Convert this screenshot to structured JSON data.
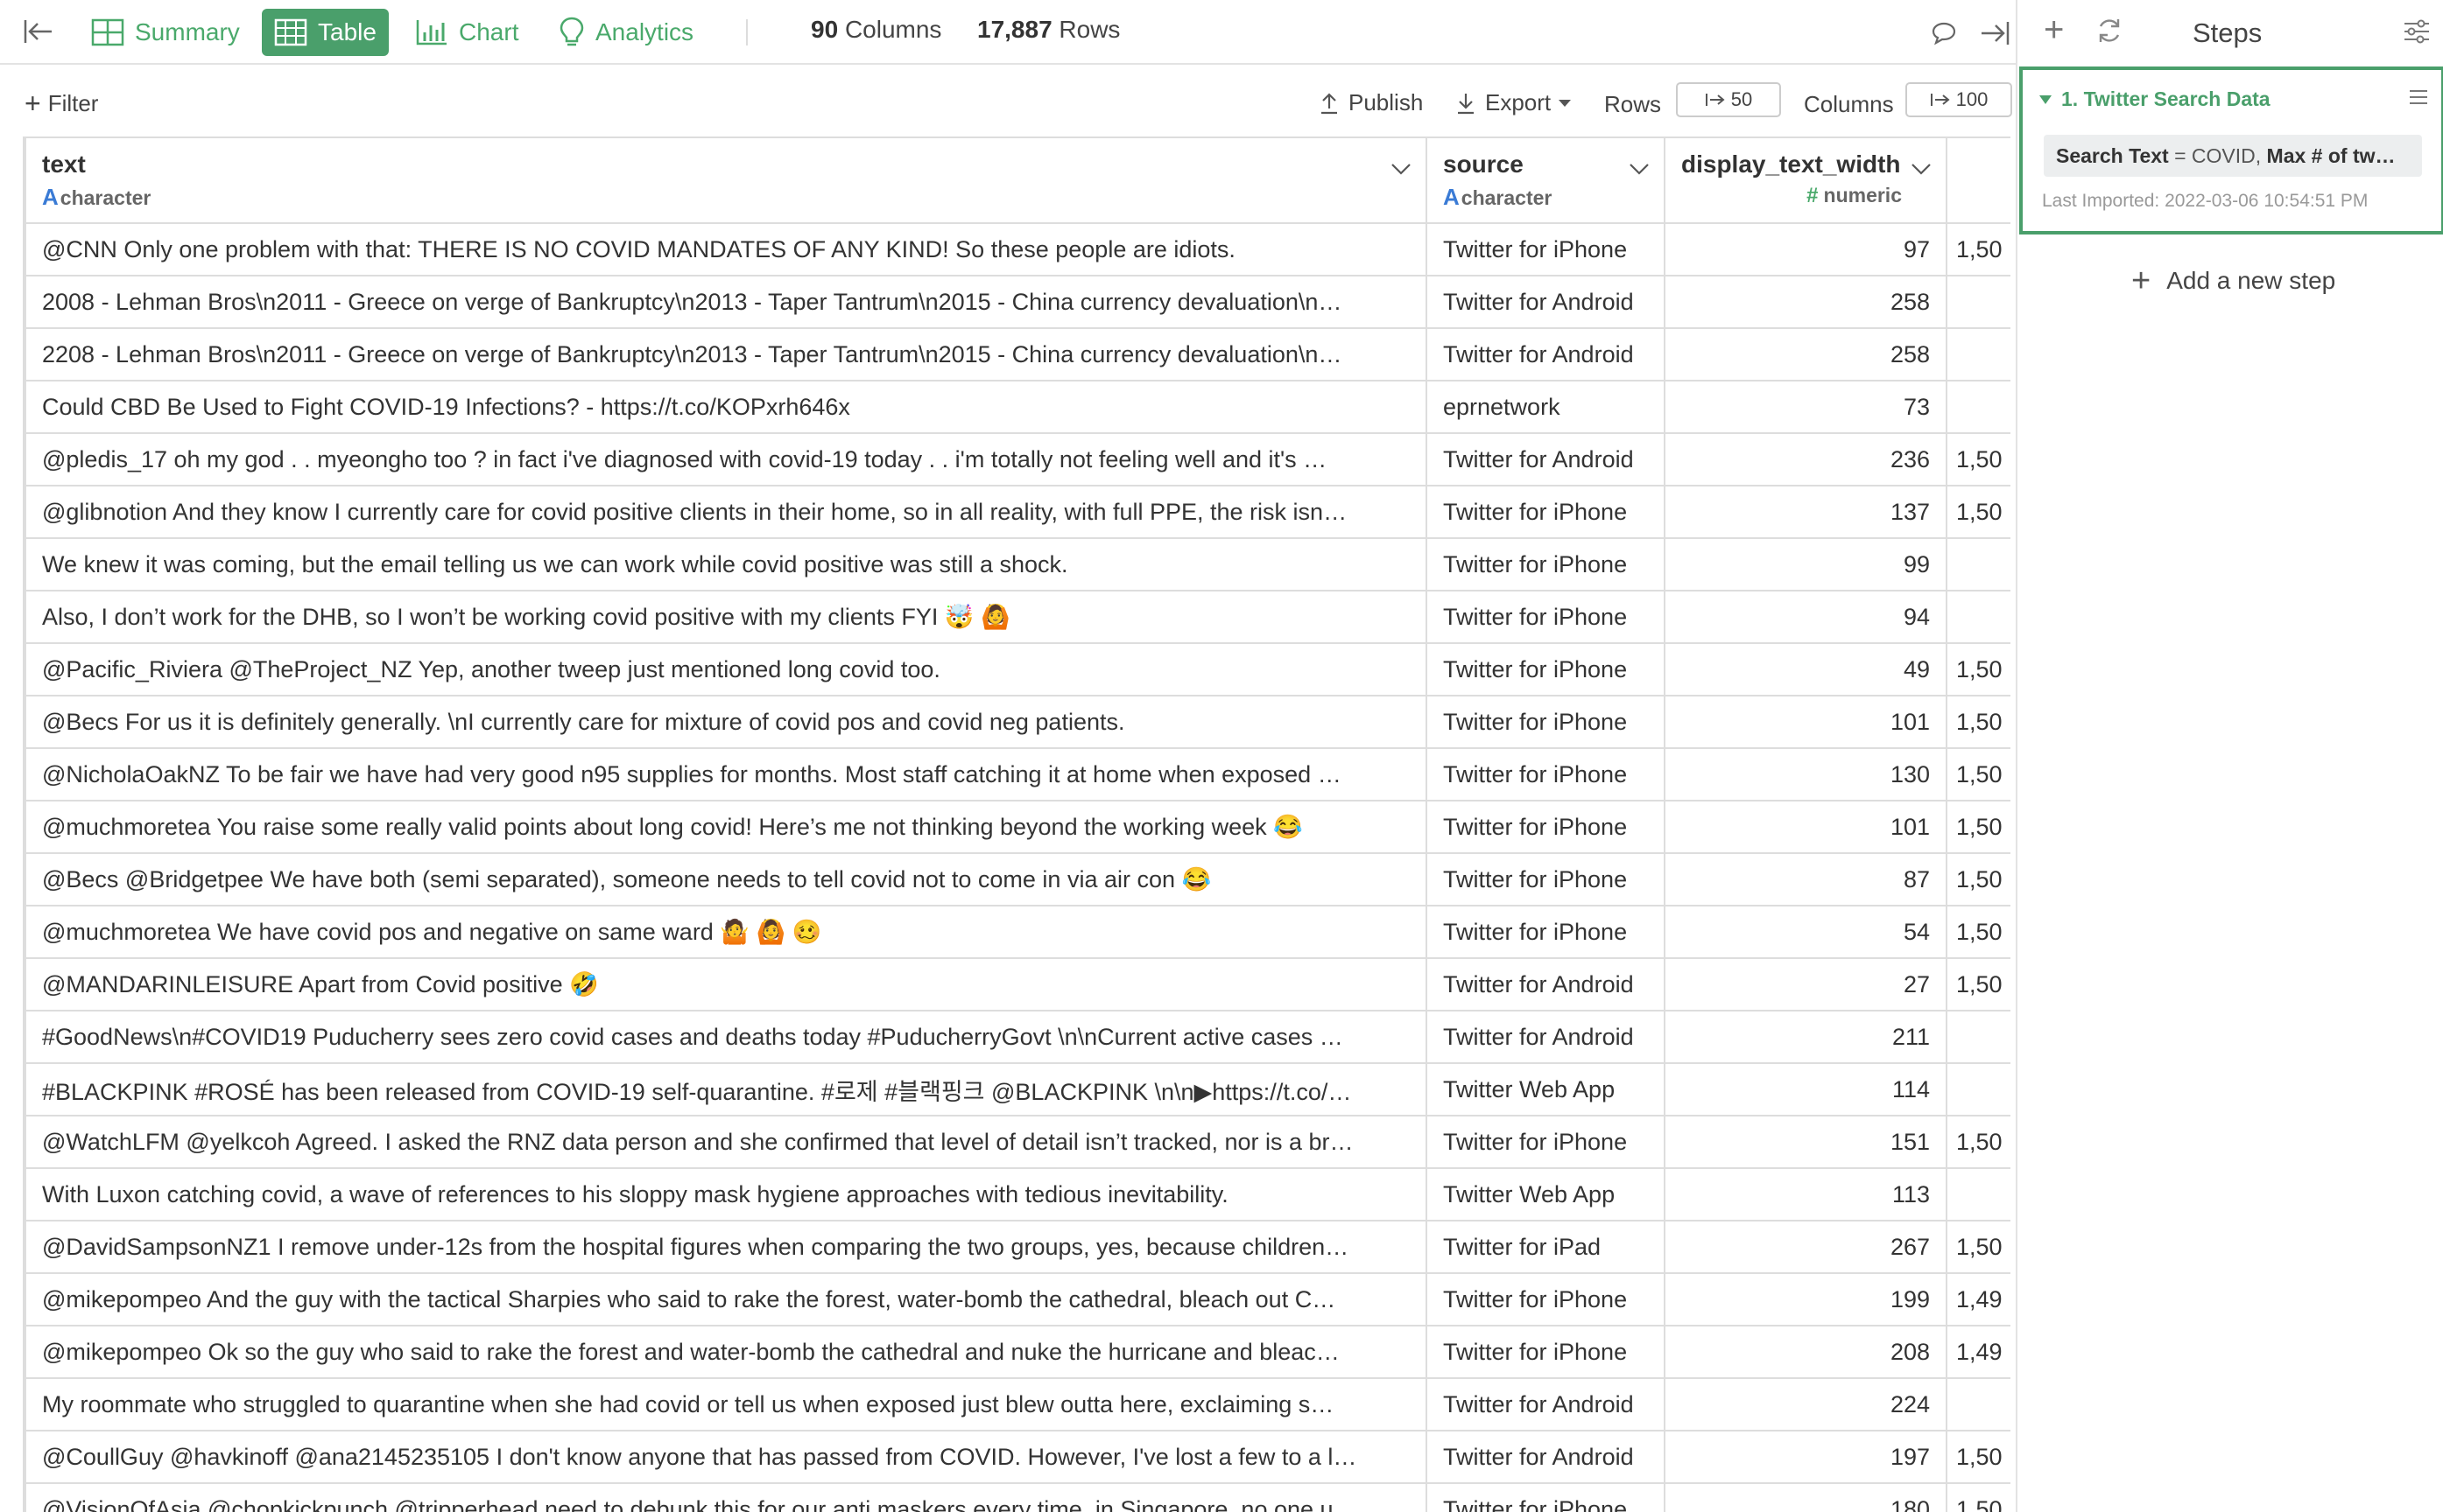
{
  "tabs": {
    "summary": "Summary",
    "table": "Table",
    "chart": "Chart",
    "analytics": "Analytics"
  },
  "stats": {
    "columns_count": "90",
    "columns_label": "Columns",
    "rows_count": "17,887",
    "rows_label": "Rows"
  },
  "toolbar": {
    "filter": "Filter",
    "publish": "Publish",
    "export": "Export",
    "rows_label": "Rows",
    "rows_value": "50",
    "columns_label": "Columns",
    "columns_value": "100"
  },
  "table": {
    "columns": [
      {
        "name": "text",
        "type": "character",
        "type_icon": "A"
      },
      {
        "name": "source",
        "type": "character",
        "type_icon": "A"
      },
      {
        "name": "display_text_width",
        "type": "numeric",
        "type_icon": "#"
      }
    ],
    "rows": [
      {
        "text": "@CNN Only one problem with that:  THERE IS NO COVID MANDATES OF ANY KIND!  So these people are idiots.",
        "source": "Twitter for iPhone",
        "width": "97",
        "extra": "1,50"
      },
      {
        "text": "2008 - Lehman Bros\\n2011 - Greece on verge of Bankruptcy\\n2013 - Taper Tantrum\\n2015 - China currency devaluation\\n…",
        "source": "Twitter for Android",
        "width": "258",
        "extra": ""
      },
      {
        "text": "2208 - Lehman Bros\\n2011 - Greece on verge of Bankruptcy\\n2013 - Taper Tantrum\\n2015 - China currency devaluation\\n…",
        "source": "Twitter for Android",
        "width": "258",
        "extra": ""
      },
      {
        "text": "Could CBD Be Used to Fight COVID-19 Infections? - https://t.co/KOPxrh646x",
        "source": "eprnetwork",
        "width": "73",
        "extra": ""
      },
      {
        "text": "@pledis_17 oh my god . . myeongho too ? in fact i've diagnosed with covid-19 today . . i'm totally not feeling well and it's …",
        "source": "Twitter for Android",
        "width": "236",
        "extra": "1,50"
      },
      {
        "text": "@glibnotion And they know I currently care for covid positive clients in their home, so in all reality, with full PPE, the risk isn…",
        "source": "Twitter for iPhone",
        "width": "137",
        "extra": "1,50"
      },
      {
        "text": "We knew it was coming, but the email telling us we can work while covid positive was still a shock.",
        "source": "Twitter for iPhone",
        "width": "99",
        "extra": ""
      },
      {
        "text": "Also, I don’t work for the DHB, so I won’t be working covid positive with my clients FYI 🤯 🙆",
        "source": "Twitter for iPhone",
        "width": "94",
        "extra": ""
      },
      {
        "text": "@Pacific_Riviera @TheProject_NZ Yep, another tweep just mentioned long covid too.",
        "source": "Twitter for iPhone",
        "width": "49",
        "extra": "1,50"
      },
      {
        "text": "@Becs For us it is definitely generally. \\nI currently care for mixture of covid pos and covid neg patients.",
        "source": "Twitter for iPhone",
        "width": "101",
        "extra": "1,50"
      },
      {
        "text": "@NicholaOakNZ To be fair we have had very good n95 supplies for months. Most staff catching it at home when exposed …",
        "source": "Twitter for iPhone",
        "width": "130",
        "extra": "1,50"
      },
      {
        "text": "@muchmoretea You raise some really valid points about long covid! Here’s me not thinking beyond the working week 😂",
        "source": "Twitter for iPhone",
        "width": "101",
        "extra": "1,50"
      },
      {
        "text": "@Becs @Bridgetpee We have both (semi separated), someone needs to tell covid not to come in via air con 😂",
        "source": "Twitter for iPhone",
        "width": "87",
        "extra": "1,50"
      },
      {
        "text": "@muchmoretea We have covid pos and negative on same ward 🤷 🙆 🥴",
        "source": "Twitter for iPhone",
        "width": "54",
        "extra": "1,50"
      },
      {
        "text": "@MANDARINLEISURE Apart from Covid positive 🤣",
        "source": "Twitter for Android",
        "width": "27",
        "extra": "1,50"
      },
      {
        "text": "#GoodNews\\n#COVID19 Puducherry sees zero covid cases and deaths today #PuducherryGovt \\n\\nCurrent active cases …",
        "source": "Twitter for Android",
        "width": "211",
        "extra": ""
      },
      {
        "text": "#BLACKPINK #ROSÉ has been released from COVID-19 self-quarantine. #로제 #블랙핑크 @BLACKPINK \\n\\n▶https://t.co/…",
        "source": "Twitter Web App",
        "width": "114",
        "extra": ""
      },
      {
        "text": "@WatchLFM @yelkcoh Agreed. I asked the RNZ data person and she confirmed that level of detail isn’t tracked, nor is a br…",
        "source": "Twitter for iPhone",
        "width": "151",
        "extra": "1,50"
      },
      {
        "text": "With Luxon catching covid, a wave of references to his sloppy mask hygiene approaches with tedious inevitability.",
        "source": "Twitter Web App",
        "width": "113",
        "extra": ""
      },
      {
        "text": "@DavidSampsonNZ1 I remove under-12s from the hospital figures when comparing the two groups, yes, because children…",
        "source": "Twitter for iPad",
        "width": "267",
        "extra": "1,50"
      },
      {
        "text": "@mikepompeo And the guy with the tactical Sharpies who said to rake the forest, water-bomb the cathedral, bleach out C…",
        "source": "Twitter for iPhone",
        "width": "199",
        "extra": "1,49"
      },
      {
        "text": "@mikepompeo Ok so the guy who said to rake the forest and water-bomb the cathedral and nuke the hurricane and bleac…",
        "source": "Twitter for iPhone",
        "width": "208",
        "extra": "1,49"
      },
      {
        "text": "My roommate who struggled to quarantine when she had covid or tell us when exposed just blew outta here, exclaiming s…",
        "source": "Twitter for Android",
        "width": "224",
        "extra": ""
      },
      {
        "text": "@CoullGuy @havkinoff @ana2145235105 I don't know anyone that has passed from COVID. However, I've lost a few to a l…",
        "source": "Twitter for Android",
        "width": "197",
        "extra": "1,50"
      },
      {
        "text": "@VisionOfAsia @chopkickpunch @tripperhead need to debunk this for our anti maskers every time, in Singapore, no one u…",
        "source": "Twitter for iPhone",
        "width": "180",
        "extra": "1,50"
      }
    ]
  },
  "steps_panel": {
    "title": "Steps",
    "step": {
      "title": "1. Twitter Search Data",
      "param_key1": "Search Text",
      "param_eq1": " = COVID, ",
      "param_key2": "Max # of tw…",
      "imported": "Last Imported: 2022-03-06 10:54:51 PM"
    },
    "add_step": "Add a new step"
  },
  "colors": {
    "accent": "#4a9f6b",
    "type_character": "#3a7bd5",
    "type_numeric": "#4aa96b"
  }
}
